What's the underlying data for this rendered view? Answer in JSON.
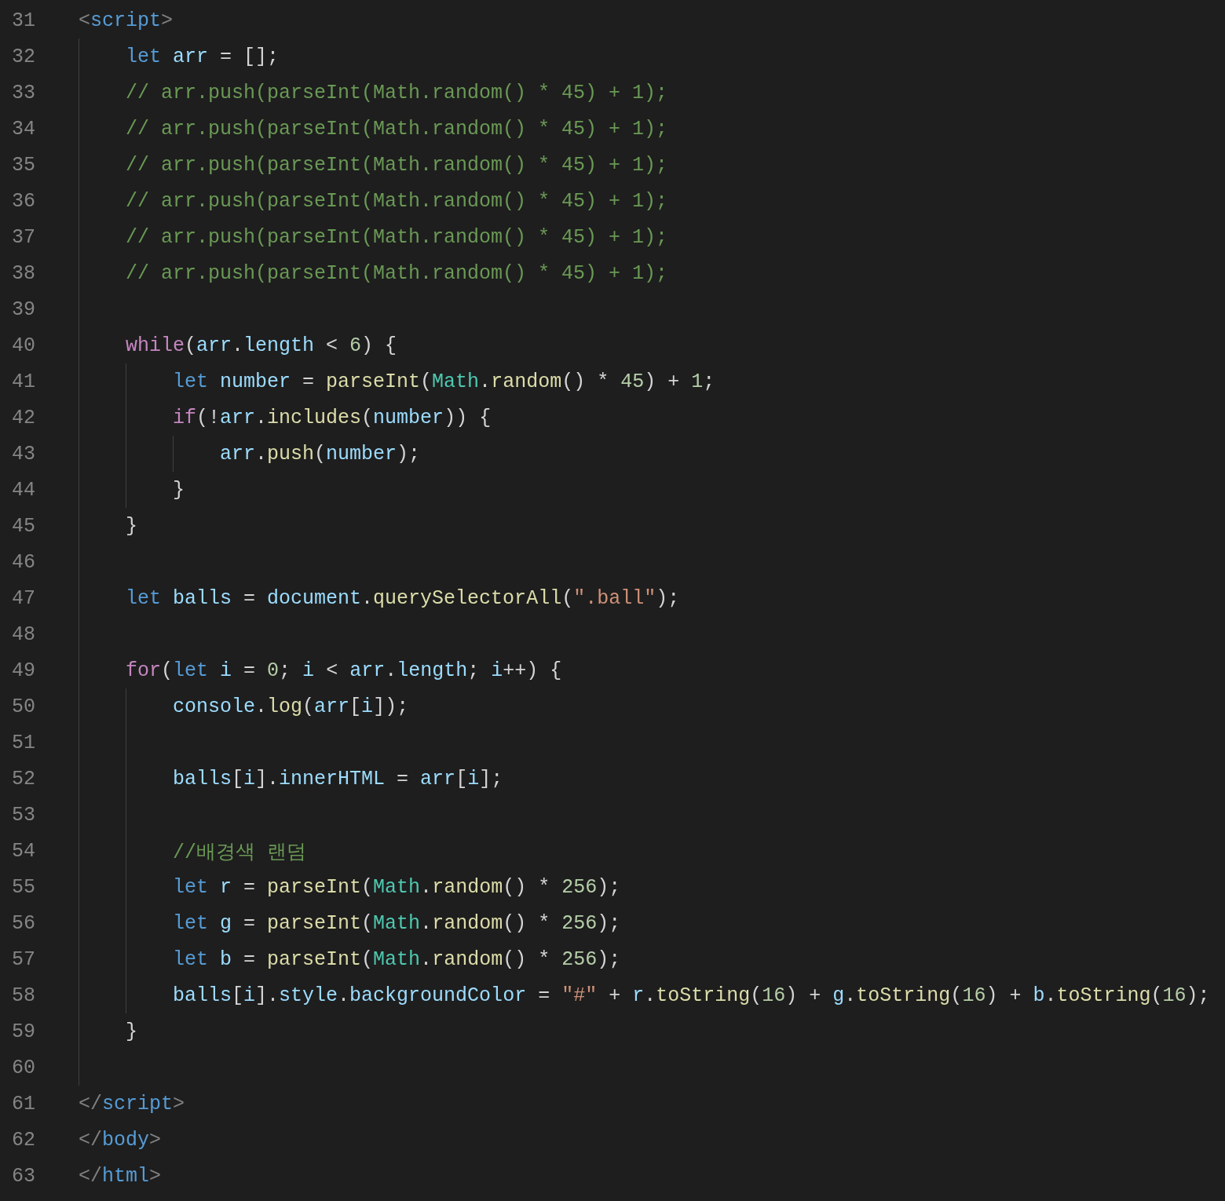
{
  "editor": {
    "lines": [
      {
        "number": "31",
        "tokens": [
          {
            "kind": "bracket",
            "text": "<"
          },
          {
            "kind": "tag",
            "text": "script"
          },
          {
            "kind": "bracket",
            "text": ">"
          }
        ],
        "children": [
          {
            "number": "32",
            "tokens": [
              {
                "kind": "keyword",
                "text": "let "
              },
              {
                "kind": "variable",
                "text": "arr"
              },
              {
                "kind": "plain",
                "text": " = [];"
              }
            ]
          },
          {
            "number": "33",
            "tokens": [
              {
                "kind": "comment",
                "text": "// arr.push(parseInt(Math.random() * 45) + 1);"
              }
            ]
          },
          {
            "number": "34",
            "tokens": [
              {
                "kind": "comment",
                "text": "// arr.push(parseInt(Math.random() * 45) + 1);"
              }
            ]
          },
          {
            "number": "35",
            "tokens": [
              {
                "kind": "comment",
                "text": "// arr.push(parseInt(Math.random() * 45) + 1);"
              }
            ]
          },
          {
            "number": "36",
            "tokens": [
              {
                "kind": "comment",
                "text": "// arr.push(parseInt(Math.random() * 45) + 1);"
              }
            ]
          },
          {
            "number": "37",
            "tokens": [
              {
                "kind": "comment",
                "text": "// arr.push(parseInt(Math.random() * 45) + 1);"
              }
            ]
          },
          {
            "number": "38",
            "tokens": [
              {
                "kind": "comment",
                "text": "// arr.push(parseInt(Math.random() * 45) + 1);"
              }
            ]
          },
          {
            "number": "39"
          },
          {
            "number": "40",
            "tokens": [
              {
                "kind": "control",
                "text": "while"
              },
              {
                "kind": "plain",
                "text": "("
              },
              {
                "kind": "variable",
                "text": "arr"
              },
              {
                "kind": "plain",
                "text": "."
              },
              {
                "kind": "variable",
                "text": "length"
              },
              {
                "kind": "plain",
                "text": " < "
              },
              {
                "kind": "number",
                "text": "6"
              },
              {
                "kind": "plain",
                "text": ") {"
              }
            ],
            "children": [
              {
                "number": "41",
                "tokens": [
                  {
                    "kind": "keyword",
                    "text": "let "
                  },
                  {
                    "kind": "variable",
                    "text": "number"
                  },
                  {
                    "kind": "plain",
                    "text": " = "
                  },
                  {
                    "kind": "function",
                    "text": "parseInt"
                  },
                  {
                    "kind": "plain",
                    "text": "("
                  },
                  {
                    "kind": "class",
                    "text": "Math"
                  },
                  {
                    "kind": "plain",
                    "text": "."
                  },
                  {
                    "kind": "function",
                    "text": "random"
                  },
                  {
                    "kind": "plain",
                    "text": "() * "
                  },
                  {
                    "kind": "number",
                    "text": "45"
                  },
                  {
                    "kind": "plain",
                    "text": ") + "
                  },
                  {
                    "kind": "number",
                    "text": "1"
                  },
                  {
                    "kind": "plain",
                    "text": ";"
                  }
                ]
              },
              {
                "number": "42",
                "tokens": [
                  {
                    "kind": "control",
                    "text": "if"
                  },
                  {
                    "kind": "plain",
                    "text": "(!"
                  },
                  {
                    "kind": "variable",
                    "text": "arr"
                  },
                  {
                    "kind": "plain",
                    "text": "."
                  },
                  {
                    "kind": "function",
                    "text": "includes"
                  },
                  {
                    "kind": "plain",
                    "text": "("
                  },
                  {
                    "kind": "variable",
                    "text": "number"
                  },
                  {
                    "kind": "plain",
                    "text": ")) {"
                  }
                ],
                "children": [
                  {
                    "number": "43",
                    "tokens": [
                      {
                        "kind": "variable",
                        "text": "arr"
                      },
                      {
                        "kind": "plain",
                        "text": "."
                      },
                      {
                        "kind": "function",
                        "text": "push"
                      },
                      {
                        "kind": "plain",
                        "text": "("
                      },
                      {
                        "kind": "variable",
                        "text": "number"
                      },
                      {
                        "kind": "plain",
                        "text": ");"
                      }
                    ]
                  }
                ]
              },
              {
                "number": "44",
                "tokens": [
                  {
                    "kind": "plain",
                    "text": "}"
                  }
                ]
              }
            ]
          },
          {
            "number": "45",
            "tokens": [
              {
                "kind": "plain",
                "text": "}"
              }
            ]
          },
          {
            "number": "46"
          },
          {
            "number": "47",
            "tokens": [
              {
                "kind": "keyword",
                "text": "let "
              },
              {
                "kind": "variable",
                "text": "balls"
              },
              {
                "kind": "plain",
                "text": " = "
              },
              {
                "kind": "variable",
                "text": "document"
              },
              {
                "kind": "plain",
                "text": "."
              },
              {
                "kind": "function",
                "text": "querySelectorAll"
              },
              {
                "kind": "plain",
                "text": "("
              },
              {
                "kind": "string",
                "text": "\".ball\""
              },
              {
                "kind": "plain",
                "text": ");"
              }
            ]
          },
          {
            "number": "48"
          },
          {
            "number": "49",
            "tokens": [
              {
                "kind": "control",
                "text": "for"
              },
              {
                "kind": "plain",
                "text": "("
              },
              {
                "kind": "keyword",
                "text": "let "
              },
              {
                "kind": "variable",
                "text": "i"
              },
              {
                "kind": "plain",
                "text": " = "
              },
              {
                "kind": "number",
                "text": "0"
              },
              {
                "kind": "plain",
                "text": "; "
              },
              {
                "kind": "variable",
                "text": "i"
              },
              {
                "kind": "plain",
                "text": " < "
              },
              {
                "kind": "variable",
                "text": "arr"
              },
              {
                "kind": "plain",
                "text": "."
              },
              {
                "kind": "variable",
                "text": "length"
              },
              {
                "kind": "plain",
                "text": "; "
              },
              {
                "kind": "variable",
                "text": "i"
              },
              {
                "kind": "plain",
                "text": "++) {"
              }
            ],
            "children": [
              {
                "number": "50",
                "tokens": [
                  {
                    "kind": "variable",
                    "text": "console"
                  },
                  {
                    "kind": "plain",
                    "text": "."
                  },
                  {
                    "kind": "function",
                    "text": "log"
                  },
                  {
                    "kind": "plain",
                    "text": "("
                  },
                  {
                    "kind": "variable",
                    "text": "arr"
                  },
                  {
                    "kind": "plain",
                    "text": "["
                  },
                  {
                    "kind": "variable",
                    "text": "i"
                  },
                  {
                    "kind": "plain",
                    "text": "]);"
                  }
                ]
              },
              {
                "number": "51"
              },
              {
                "number": "52",
                "tokens": [
                  {
                    "kind": "variable",
                    "text": "balls"
                  },
                  {
                    "kind": "plain",
                    "text": "["
                  },
                  {
                    "kind": "variable",
                    "text": "i"
                  },
                  {
                    "kind": "plain",
                    "text": "]."
                  },
                  {
                    "kind": "variable",
                    "text": "innerHTML"
                  },
                  {
                    "kind": "plain",
                    "text": " = "
                  },
                  {
                    "kind": "variable",
                    "text": "arr"
                  },
                  {
                    "kind": "plain",
                    "text": "["
                  },
                  {
                    "kind": "variable",
                    "text": "i"
                  },
                  {
                    "kind": "plain",
                    "text": "];"
                  }
                ]
              },
              {
                "number": "53"
              },
              {
                "number": "54",
                "tokens": [
                  {
                    "kind": "comment",
                    "text": "//배경색 랜덤"
                  }
                ]
              },
              {
                "number": "55",
                "tokens": [
                  {
                    "kind": "keyword",
                    "text": "let "
                  },
                  {
                    "kind": "variable",
                    "text": "r"
                  },
                  {
                    "kind": "plain",
                    "text": " = "
                  },
                  {
                    "kind": "function",
                    "text": "parseInt"
                  },
                  {
                    "kind": "plain",
                    "text": "("
                  },
                  {
                    "kind": "class",
                    "text": "Math"
                  },
                  {
                    "kind": "plain",
                    "text": "."
                  },
                  {
                    "kind": "function",
                    "text": "random"
                  },
                  {
                    "kind": "plain",
                    "text": "() * "
                  },
                  {
                    "kind": "number",
                    "text": "256"
                  },
                  {
                    "kind": "plain",
                    "text": ");"
                  }
                ]
              },
              {
                "number": "56",
                "tokens": [
                  {
                    "kind": "keyword",
                    "text": "let "
                  },
                  {
                    "kind": "variable",
                    "text": "g"
                  },
                  {
                    "kind": "plain",
                    "text": " = "
                  },
                  {
                    "kind": "function",
                    "text": "parseInt"
                  },
                  {
                    "kind": "plain",
                    "text": "("
                  },
                  {
                    "kind": "class",
                    "text": "Math"
                  },
                  {
                    "kind": "plain",
                    "text": "."
                  },
                  {
                    "kind": "function",
                    "text": "random"
                  },
                  {
                    "kind": "plain",
                    "text": "() * "
                  },
                  {
                    "kind": "number",
                    "text": "256"
                  },
                  {
                    "kind": "plain",
                    "text": ");"
                  }
                ]
              },
              {
                "number": "57",
                "tokens": [
                  {
                    "kind": "keyword",
                    "text": "let "
                  },
                  {
                    "kind": "variable",
                    "text": "b"
                  },
                  {
                    "kind": "plain",
                    "text": " = "
                  },
                  {
                    "kind": "function",
                    "text": "parseInt"
                  },
                  {
                    "kind": "plain",
                    "text": "("
                  },
                  {
                    "kind": "class",
                    "text": "Math"
                  },
                  {
                    "kind": "plain",
                    "text": "."
                  },
                  {
                    "kind": "function",
                    "text": "random"
                  },
                  {
                    "kind": "plain",
                    "text": "() * "
                  },
                  {
                    "kind": "number",
                    "text": "256"
                  },
                  {
                    "kind": "plain",
                    "text": ");"
                  }
                ]
              },
              {
                "number": "58",
                "tokens": [
                  {
                    "kind": "variable",
                    "text": "balls"
                  },
                  {
                    "kind": "plain",
                    "text": "["
                  },
                  {
                    "kind": "variable",
                    "text": "i"
                  },
                  {
                    "kind": "plain",
                    "text": "]."
                  },
                  {
                    "kind": "variable",
                    "text": "style"
                  },
                  {
                    "kind": "plain",
                    "text": "."
                  },
                  {
                    "kind": "variable",
                    "text": "backgroundColor"
                  },
                  {
                    "kind": "plain",
                    "text": " = "
                  },
                  {
                    "kind": "string",
                    "text": "\"#\""
                  },
                  {
                    "kind": "plain",
                    "text": " + "
                  },
                  {
                    "kind": "variable",
                    "text": "r"
                  },
                  {
                    "kind": "plain",
                    "text": "."
                  },
                  {
                    "kind": "function",
                    "text": "toString"
                  },
                  {
                    "kind": "plain",
                    "text": "("
                  },
                  {
                    "kind": "number",
                    "text": "16"
                  },
                  {
                    "kind": "plain",
                    "text": ") + "
                  },
                  {
                    "kind": "variable",
                    "text": "g"
                  },
                  {
                    "kind": "plain",
                    "text": "."
                  },
                  {
                    "kind": "function",
                    "text": "toString"
                  },
                  {
                    "kind": "plain",
                    "text": "("
                  },
                  {
                    "kind": "number",
                    "text": "16"
                  },
                  {
                    "kind": "plain",
                    "text": ") + "
                  },
                  {
                    "kind": "variable",
                    "text": "b"
                  },
                  {
                    "kind": "plain",
                    "text": "."
                  },
                  {
                    "kind": "function",
                    "text": "toString"
                  },
                  {
                    "kind": "plain",
                    "text": "("
                  },
                  {
                    "kind": "number",
                    "text": "16"
                  },
                  {
                    "kind": "plain",
                    "text": ");"
                  }
                ]
              }
            ]
          },
          {
            "number": "59",
            "tokens": [
              {
                "kind": "plain",
                "text": "}"
              }
            ]
          },
          {
            "number": "60"
          }
        ]
      },
      {
        "number": "61",
        "tokens": [
          {
            "kind": "bracket",
            "text": "</"
          },
          {
            "kind": "tag",
            "text": "script"
          },
          {
            "kind": "bracket",
            "text": ">"
          }
        ]
      },
      {
        "number": "62",
        "tokens": [
          {
            "kind": "bracket",
            "text": "</"
          },
          {
            "kind": "tag",
            "text": "body"
          },
          {
            "kind": "bracket",
            "text": ">"
          }
        ]
      },
      {
        "number": "63",
        "tokens": [
          {
            "kind": "bracket",
            "text": "</"
          },
          {
            "kind": "tag",
            "text": "html"
          },
          {
            "kind": "bracket",
            "text": ">"
          }
        ]
      }
    ]
  }
}
